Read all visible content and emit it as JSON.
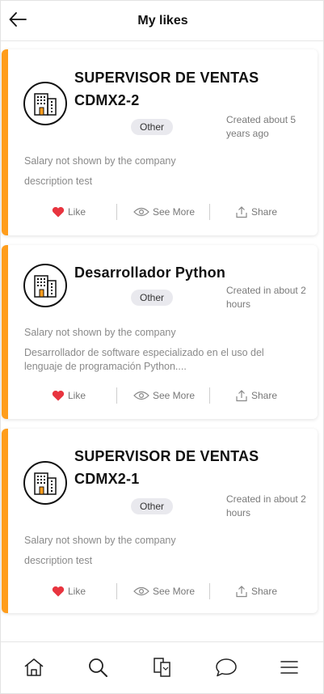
{
  "header": {
    "title": "My likes",
    "back_icon": "arrow-left-icon"
  },
  "colors": {
    "accent": "#ff9d1c",
    "heart": "#e8343f",
    "badge_bg": "#e9e9ee"
  },
  "cards": [
    {
      "title": "SUPERVISOR DE VENTAS CDMX2-2",
      "category": "Other",
      "created": "Created about 5 years ago",
      "salary": "Salary not shown by the company",
      "description": "description test",
      "actions": {
        "like": "Like",
        "see_more": "See More",
        "share": "Share"
      }
    },
    {
      "title": "Desarrollador Python",
      "category": "Other",
      "created": "Created in about 2 hours",
      "salary": "Salary not shown by the company",
      "description": "Desarrollador de software especializado en el uso del lenguaje de programación Python....",
      "actions": {
        "like": "Like",
        "see_more": "See More",
        "share": "Share"
      }
    },
    {
      "title": "SUPERVISOR DE VENTAS CDMX2-1",
      "category": "Other",
      "created": "Created in about 2 hours",
      "salary": "Salary not shown by the company",
      "description": "description test",
      "actions": {
        "like": "Like",
        "see_more": "See More",
        "share": "Share"
      }
    }
  ],
  "bottom_nav": {
    "items": [
      "home-icon",
      "search-icon",
      "documents-icon",
      "chat-icon",
      "menu-icon"
    ]
  }
}
